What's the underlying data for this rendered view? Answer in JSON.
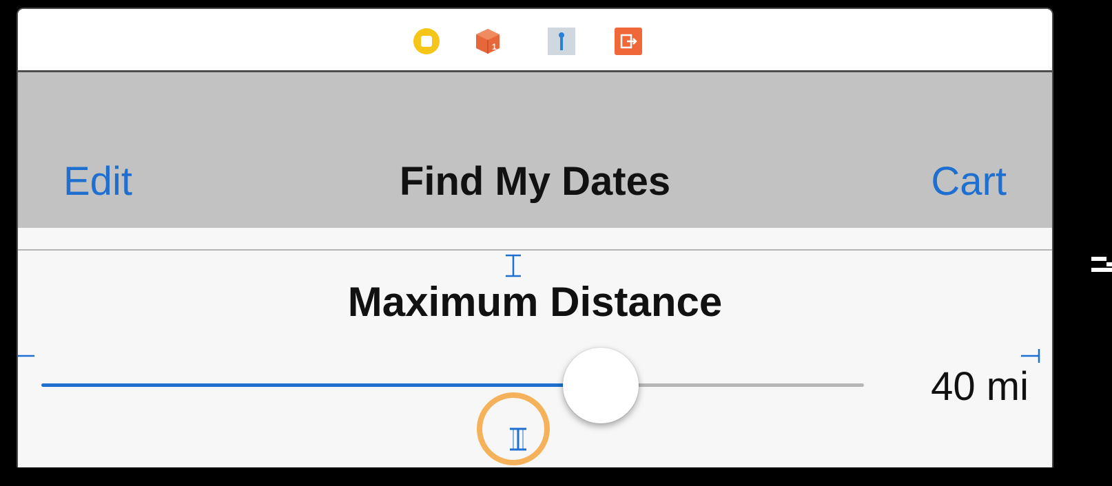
{
  "scene_dock": {
    "icons": [
      {
        "name": "view-controller-icon",
        "color": "#f5c518"
      },
      {
        "name": "first-responder-icon",
        "color": "#e8673a"
      },
      {
        "name": "exit-segue-icon",
        "color": "#3a8ee6"
      },
      {
        "name": "exit-icon",
        "color": "#f0673a"
      }
    ]
  },
  "navbar": {
    "left_button": "Edit",
    "title": "Find My Dates",
    "right_button": "Cart"
  },
  "content": {
    "section_title": "Maximum Distance",
    "slider": {
      "value_label": "40 mi",
      "fraction": 0.68,
      "min_track_color": "#1e6fd0",
      "max_track_color": "#b6b6b6"
    }
  },
  "colors": {
    "accent": "#1e6fd0",
    "navbar_bg": "#c2c2c2",
    "focus_ring": "#f5b25a",
    "constraint": "#1e6fd0"
  }
}
